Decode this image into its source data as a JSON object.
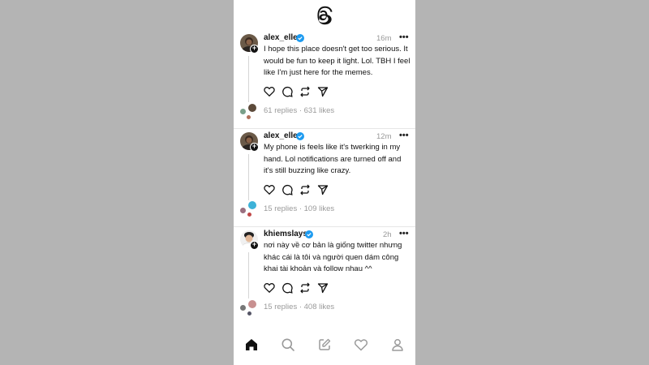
{
  "app": {
    "logo": "threads-logo-icon"
  },
  "posts": [
    {
      "username": "alex_elle",
      "time": "16m",
      "text": "I hope this place doesn't get too serious. It would be fun to keep it light. Lol. TBH I feel like I'm just here for the memes.",
      "stats": "61 replies · 631 likes"
    },
    {
      "username": "alex_elle",
      "time": "12m",
      "text": "My phone is feels like it's twerking in my hand. Lol notifications are turned off and it's still buzzing like crazy.",
      "stats": "15 replies · 109 likes"
    },
    {
      "username": "khiemslays",
      "time": "2h",
      "text": "nơi này về cơ bản là giống twitter nhưng khác cái là tôi và người quen dám công khai tài khoản và follow nhau ^^",
      "stats": "15 replies · 408 likes"
    }
  ],
  "icons": {
    "more": "•••",
    "plus": "+",
    "actions": [
      "heart-icon",
      "comment-icon",
      "repost-icon",
      "send-icon"
    ],
    "nav": [
      "home-icon",
      "search-icon",
      "compose-icon",
      "activity-icon",
      "profile-icon"
    ]
  },
  "colors": {
    "verified": "#1d9bf0",
    "muted": "#999999"
  }
}
